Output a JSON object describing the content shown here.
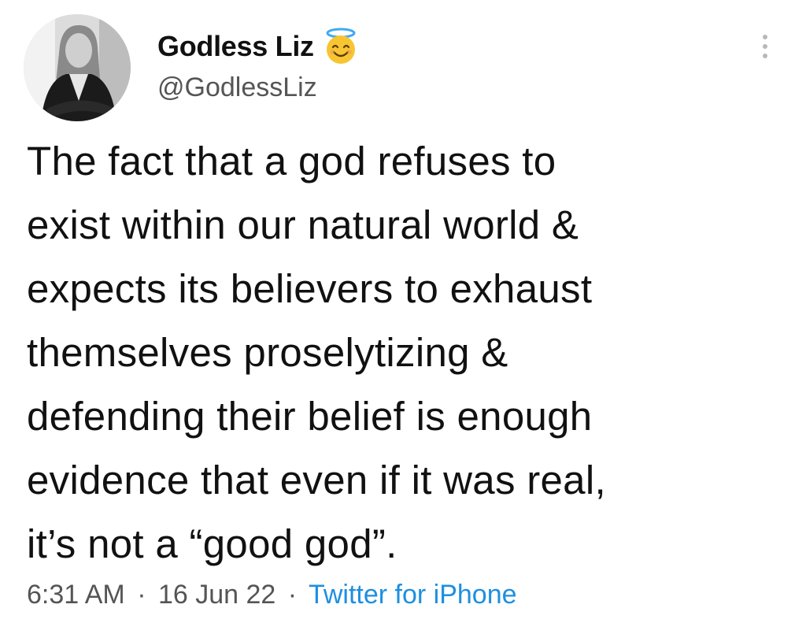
{
  "author": {
    "display_name": "Godless Liz",
    "handle": "@GodlessLiz",
    "badge_icon": "smiling-face-with-halo-icon"
  },
  "tweet": {
    "lines": [
      "The fact that a god refuses to",
      "exist within our natural world &",
      "expects its believers to exhaust",
      "themselves proselytizing &",
      "defending their belief is enough",
      "evidence that even if it was real,",
      "it’s not a “good god”."
    ],
    "time": "6:31 AM",
    "separator": "·",
    "date": "16 Jun 22",
    "source": "Twitter for iPhone"
  },
  "colors": {
    "text": "#111111",
    "secondary": "#555555",
    "link": "#1d8fe0",
    "halo_emoji": "#f7c531"
  }
}
